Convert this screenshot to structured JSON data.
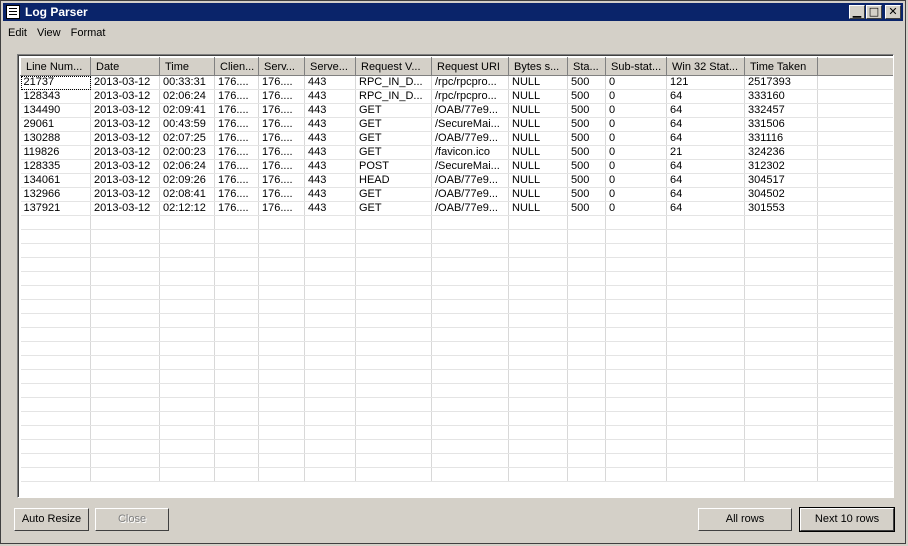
{
  "window": {
    "title": "Log Parser"
  },
  "menu": [
    "Edit",
    "View",
    "Format"
  ],
  "columns": [
    {
      "label": "Line Num...",
      "w": 70
    },
    {
      "label": "Date",
      "w": 69
    },
    {
      "label": "Time",
      "w": 55
    },
    {
      "label": "Clien...",
      "w": 44
    },
    {
      "label": "Serv...",
      "w": 46
    },
    {
      "label": "Serve...",
      "w": 51
    },
    {
      "label": "Request V...",
      "w": 76
    },
    {
      "label": "Request URI",
      "w": 77
    },
    {
      "label": "Bytes s...",
      "w": 59
    },
    {
      "label": "Sta...",
      "w": 38
    },
    {
      "label": "Sub-stat...",
      "w": 61
    },
    {
      "label": "Win 32 Stat...",
      "w": 78
    },
    {
      "label": "Time Taken",
      "w": 73
    },
    {
      "label": "",
      "w": 76
    }
  ],
  "rows": [
    [
      "21737",
      "2013-03-12",
      "00:33:31",
      "176....",
      "176....",
      "443",
      "RPC_IN_D...",
      "/rpc/rpcpro...",
      "NULL",
      "500",
      "0",
      "121",
      "2517393"
    ],
    [
      "128343",
      "2013-03-12",
      "02:06:24",
      "176....",
      "176....",
      "443",
      "RPC_IN_D...",
      "/rpc/rpcpro...",
      "NULL",
      "500",
      "0",
      "64",
      "333160"
    ],
    [
      "134490",
      "2013-03-12",
      "02:09:41",
      "176....",
      "176....",
      "443",
      "GET",
      "/OAB/77e9...",
      "NULL",
      "500",
      "0",
      "64",
      "332457"
    ],
    [
      "29061",
      "2013-03-12",
      "00:43:59",
      "176....",
      "176....",
      "443",
      "GET",
      "/SecureMai...",
      "NULL",
      "500",
      "0",
      "64",
      "331506"
    ],
    [
      "130288",
      "2013-03-12",
      "02:07:25",
      "176....",
      "176....",
      "443",
      "GET",
      "/OAB/77e9...",
      "NULL",
      "500",
      "0",
      "64",
      "331116"
    ],
    [
      "119826",
      "2013-03-12",
      "02:00:23",
      "176....",
      "176....",
      "443",
      "GET",
      "/favicon.ico",
      "NULL",
      "500",
      "0",
      "21",
      "324236"
    ],
    [
      "128335",
      "2013-03-12",
      "02:06:24",
      "176....",
      "176....",
      "443",
      "POST",
      "/SecureMai...",
      "NULL",
      "500",
      "0",
      "64",
      "312302"
    ],
    [
      "134061",
      "2013-03-12",
      "02:09:26",
      "176....",
      "176....",
      "443",
      "HEAD",
      "/OAB/77e9...",
      "NULL",
      "500",
      "0",
      "64",
      "304517"
    ],
    [
      "132966",
      "2013-03-12",
      "02:08:41",
      "176....",
      "176....",
      "443",
      "GET",
      "/OAB/77e9...",
      "NULL",
      "500",
      "0",
      "64",
      "304502"
    ],
    [
      "137921",
      "2013-03-12",
      "02:12:12",
      "176....",
      "176....",
      "443",
      "GET",
      "/OAB/77e9...",
      "NULL",
      "500",
      "0",
      "64",
      "301553"
    ]
  ],
  "buttons": {
    "auto_resize": "Auto Resize",
    "close": "Close",
    "all_rows": "All rows",
    "next_rows": "Next 10 rows"
  }
}
